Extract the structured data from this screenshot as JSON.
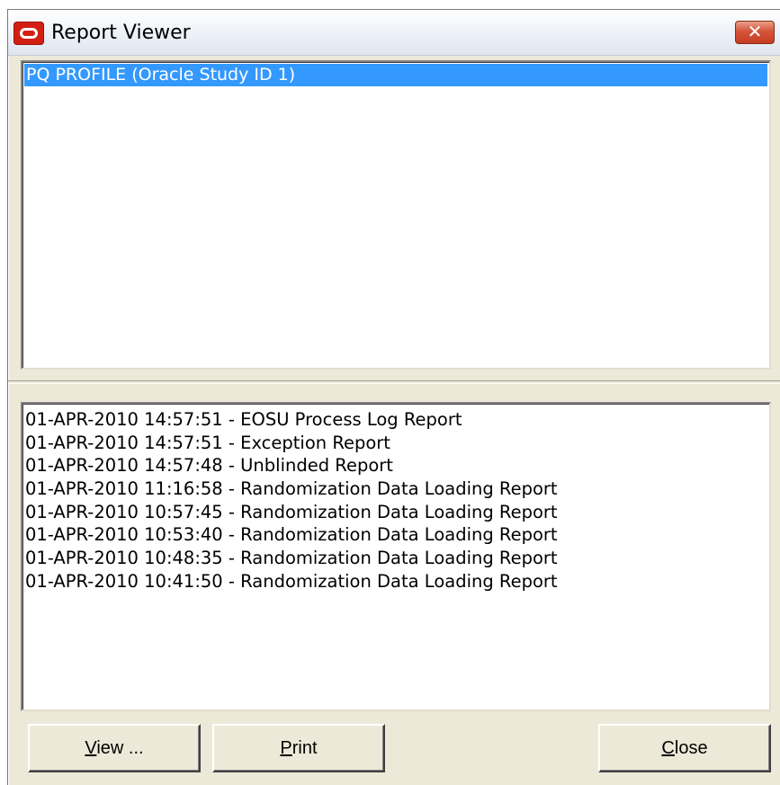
{
  "window": {
    "title": "Report Viewer",
    "close_glyph": "✕",
    "icon": "oracle-logo-icon"
  },
  "studies": {
    "items": [
      {
        "label": "PQ PROFILE (Oracle Study ID 1)",
        "selected": true
      }
    ]
  },
  "reports": {
    "items": [
      "01-APR-2010 14:57:51 - EOSU Process Log Report",
      "01-APR-2010 14:57:51 - Exception Report",
      "01-APR-2010 14:57:48 - Unblinded Report",
      "01-APR-2010 11:16:58 - Randomization Data Loading Report",
      "01-APR-2010 10:57:45 - Randomization Data Loading Report",
      "01-APR-2010 10:53:40 - Randomization Data Loading Report",
      "01-APR-2010 10:48:35 - Randomization Data Loading Report",
      "01-APR-2010 10:41:50 - Randomization Data Loading Report"
    ]
  },
  "buttons": {
    "view": {
      "mnemonic": "V",
      "rest": "iew ..."
    },
    "print": {
      "mnemonic": "P",
      "rest": "rint"
    },
    "close": {
      "mnemonic": "C",
      "rest": "lose"
    }
  },
  "colors": {
    "selection": "#3399ff",
    "window_bg": "#ece9d8",
    "close_button": "#d4543a",
    "icon_red": "#d21f12"
  }
}
